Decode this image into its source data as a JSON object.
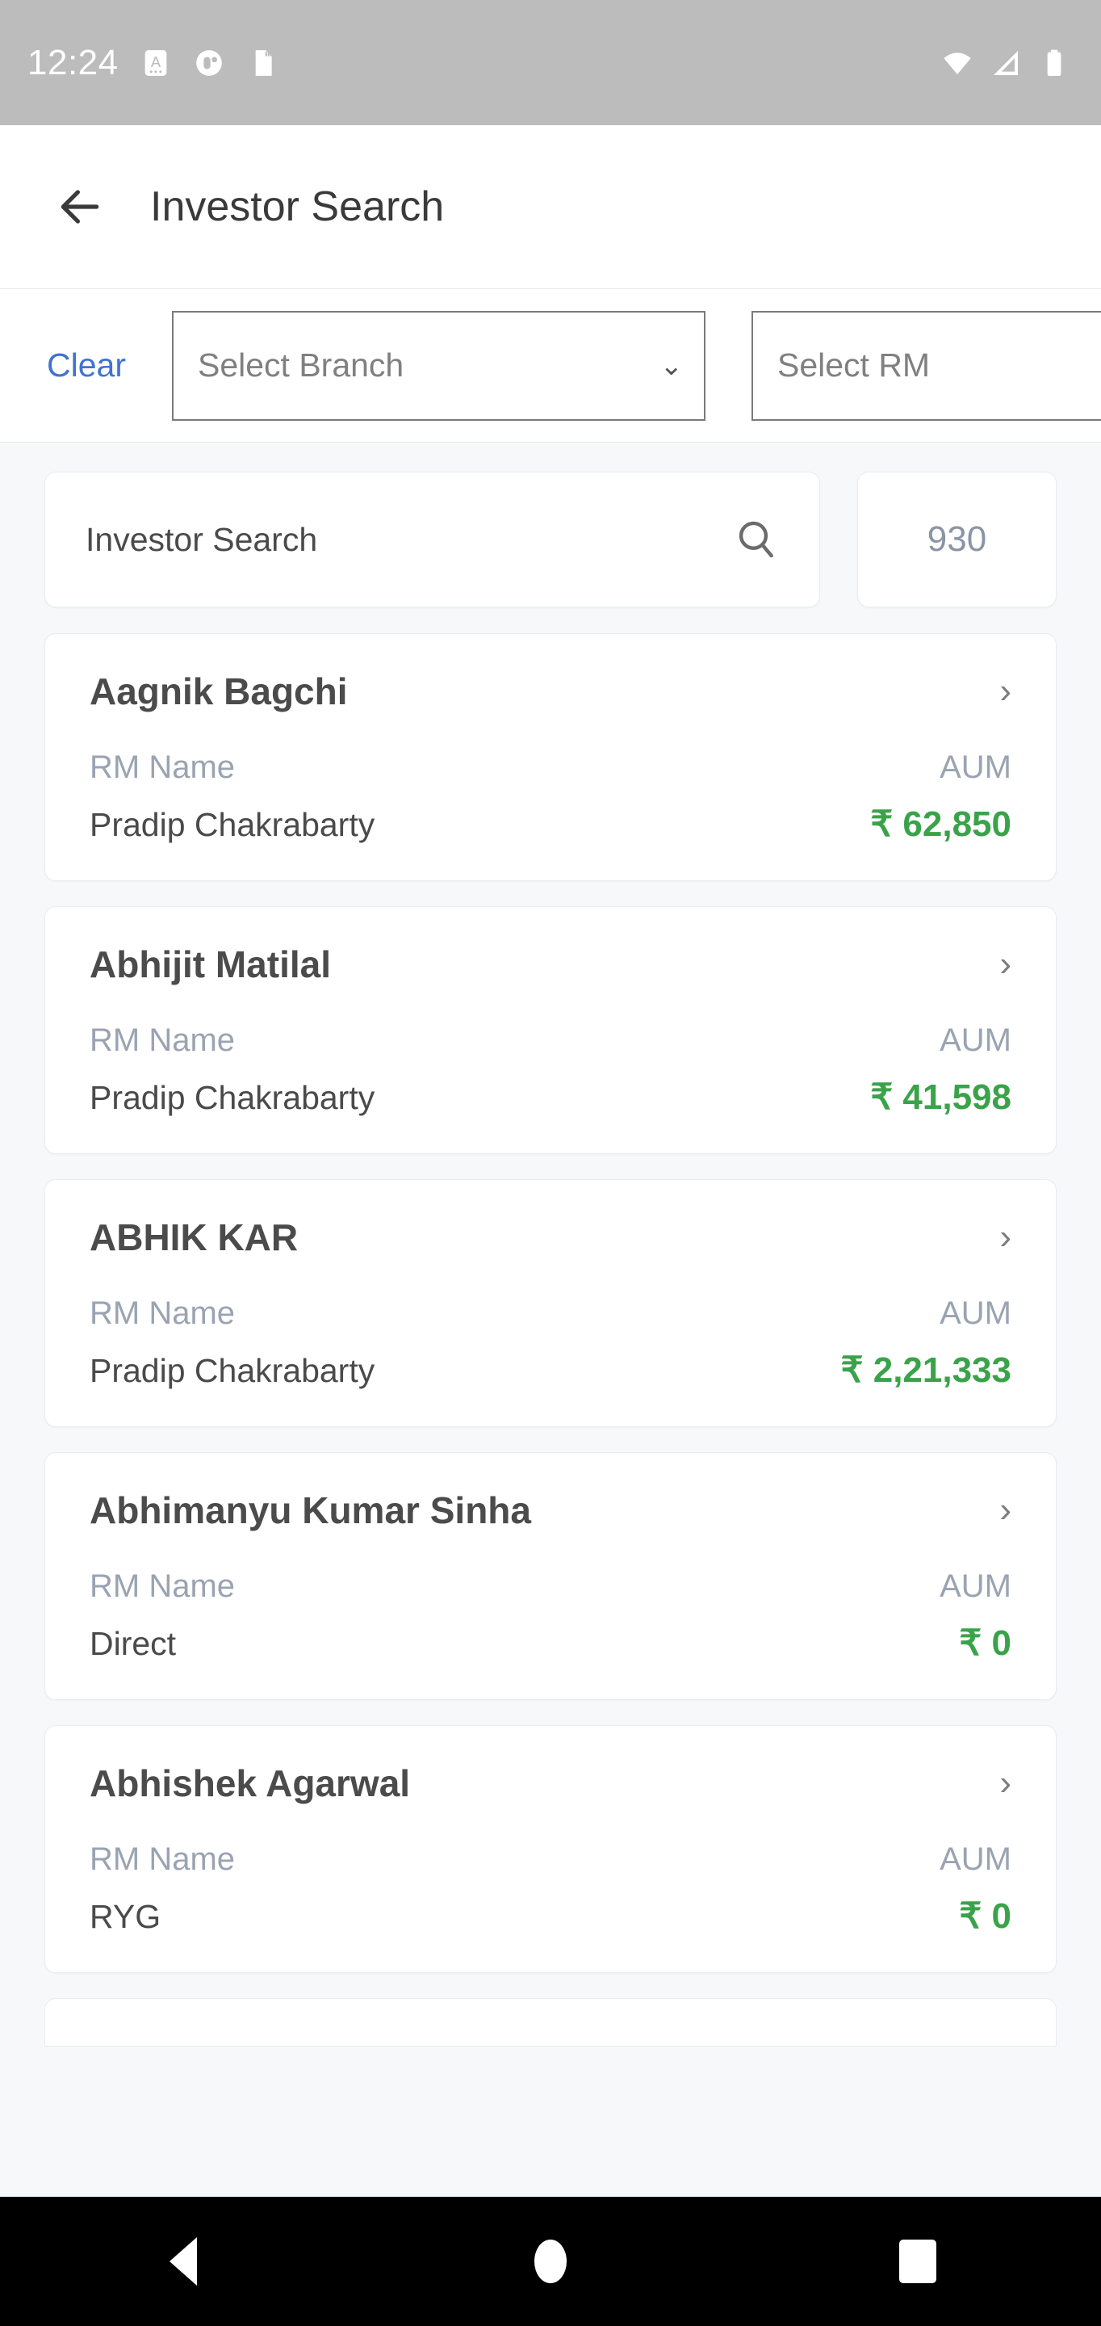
{
  "status_bar": {
    "time": "12:24",
    "left_icons": [
      "font-size-app-icon",
      "circle-app-icon",
      "sd-card-icon"
    ],
    "right_icons": [
      "wifi-icon",
      "cellular-signal-icon",
      "battery-icon"
    ]
  },
  "app_bar": {
    "back_icon": "arrow-left-icon",
    "title": "Investor Search"
  },
  "filters": {
    "clear_label": "Clear",
    "branch_placeholder": "Select Branch",
    "branch_value": "",
    "rm_placeholder": "Select RM",
    "rm_value": "",
    "dropdown_icon": "chevron-down-icon"
  },
  "search": {
    "placeholder": "Investor Search",
    "value": "",
    "icon": "search-icon",
    "result_count": "930"
  },
  "list": {
    "labels": {
      "rm_name": "RM Name",
      "aum": "AUM"
    },
    "chevron_icon": "chevron-right-icon",
    "items": [
      {
        "name": "Aagnik Bagchi",
        "rm": "Pradip Chakrabarty",
        "aum": "₹ 62,850"
      },
      {
        "name": "Abhijit Matilal",
        "rm": "Pradip Chakrabarty",
        "aum": "₹ 41,598"
      },
      {
        "name": "ABHIK KAR",
        "rm": "Pradip Chakrabarty",
        "aum": "₹ 2,21,333"
      },
      {
        "name": "Abhimanyu Kumar Sinha",
        "rm": "Direct",
        "aum": "₹ 0"
      },
      {
        "name": "Abhishek Agarwal",
        "rm": "RYG",
        "aum": "₹ 0"
      }
    ]
  },
  "nav_bar": {
    "back_icon": "triangle-back-icon",
    "home_icon": "circle-home-icon",
    "recents_icon": "square-recents-icon"
  },
  "colors": {
    "accent_link": "#3f72d4",
    "aum_green": "#3aa34a",
    "count_grey": "#8a94a6",
    "page_bg": "#f6f8fa",
    "status_bar_bg": "#bcbcbc"
  }
}
